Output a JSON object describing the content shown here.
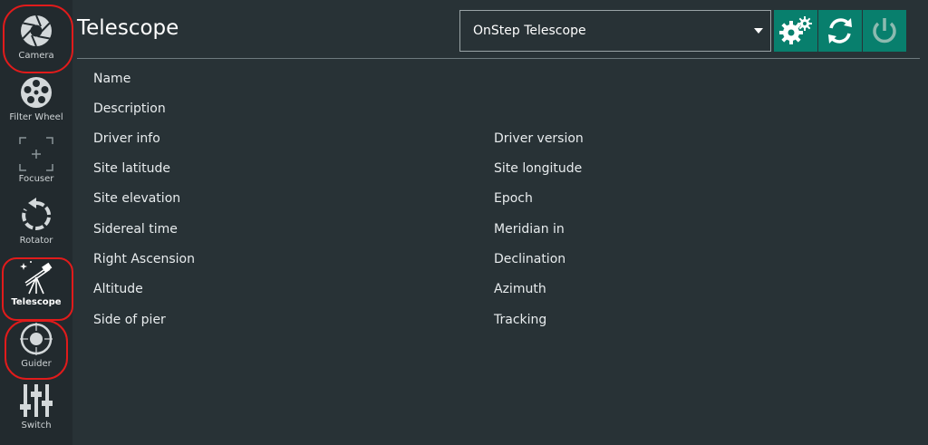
{
  "sidebar": {
    "items": [
      {
        "label": "Camera",
        "icon": "camera-aperture-icon"
      },
      {
        "label": "Filter Wheel",
        "icon": "filter-wheel-icon"
      },
      {
        "label": "Focuser",
        "icon": "focuser-icon"
      },
      {
        "label": "Rotator",
        "icon": "rotator-icon"
      },
      {
        "label": "Telescope",
        "icon": "telescope-icon"
      },
      {
        "label": "Guider",
        "icon": "guider-icon"
      },
      {
        "label": "Switch",
        "icon": "switch-sliders-icon"
      }
    ],
    "active": "Telescope"
  },
  "header": {
    "title": "Telescope",
    "device_select": {
      "value": "OnStep Telescope"
    },
    "buttons": [
      {
        "icon": "settings-gears-icon"
      },
      {
        "icon": "refresh-icon"
      },
      {
        "icon": "power-icon"
      }
    ]
  },
  "properties": {
    "left": [
      "Name",
      "Description",
      "Driver info",
      "Site latitude",
      "Site elevation",
      "Sidereal time",
      "Right Ascension",
      "Altitude",
      "Side of pier"
    ],
    "right": [
      "Driver version",
      "Site longitude",
      "Epoch",
      "Meridian in",
      "Declination",
      "Azimuth",
      "Tracking"
    ]
  },
  "colors": {
    "background": "#283236",
    "sidebar": "#222a2e",
    "accent": "#087f6d",
    "annotation": "#e11b1b"
  }
}
